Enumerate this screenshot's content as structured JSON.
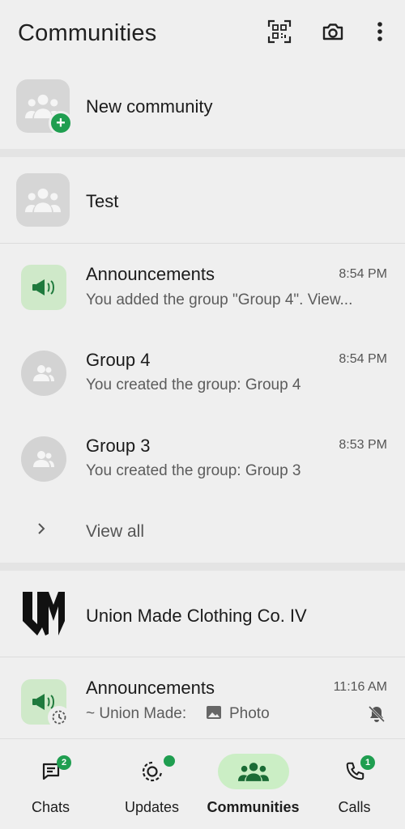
{
  "header": {
    "title": "Communities",
    "icons": [
      "qr-scan-icon",
      "camera-icon",
      "more-vert-icon"
    ]
  },
  "new_community": {
    "label": "New community"
  },
  "community_1": {
    "name": "Test",
    "chats": [
      {
        "title": "Announcements",
        "preview": "You added the group \"Group 4\". View...",
        "time": "8:54 PM"
      },
      {
        "title": "Group 4",
        "preview": "You created the group: Group 4",
        "time": "8:54 PM"
      },
      {
        "title": "Group 3",
        "preview": "You created the group: Group 3",
        "time": "8:53 PM"
      }
    ],
    "view_all": "View all"
  },
  "community_2": {
    "name": "Union Made Clothing Co. IV",
    "logo_text": "UM",
    "chats": [
      {
        "title": "Announcements",
        "preview_sender": "~ Union Made:",
        "preview_media": "Photo",
        "time": "11:16 AM"
      }
    ]
  },
  "nav": {
    "items": [
      {
        "label": "Chats",
        "badge": "2"
      },
      {
        "label": "Updates"
      },
      {
        "label": "Communities"
      },
      {
        "label": "Calls",
        "badge": "1"
      }
    ],
    "active": "Communities"
  },
  "colors": {
    "accent": "#1f9e50",
    "active_pill": "#cbeec5",
    "background": "#efefef"
  }
}
